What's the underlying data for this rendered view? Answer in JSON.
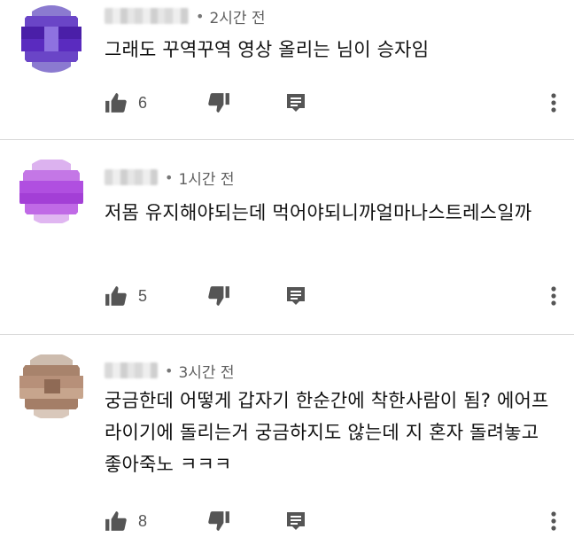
{
  "comments": [
    {
      "time_ago": "2시간 전",
      "separator": "•",
      "text": "그래도 꾸역꾸역 영상 올리는 님이 승자임",
      "likes": "6",
      "avatar_color": "#5a2bbf"
    },
    {
      "time_ago": "1시간 전",
      "separator": "•",
      "text": "저몸 유지해야되는데 먹어야되니까얼마나스트레스일까",
      "likes": "5",
      "avatar_color": "#b04fe0"
    },
    {
      "time_ago": "3시간 전",
      "separator": "•",
      "text": "궁금한데 어떻게 갑자기 한순간에 착한사람이 됨? 에어프라이기에 돌리는거 궁금하지도 않는데 지 혼자 돌려놓고 좋아죽노 ㅋㅋㅋ",
      "likes": "8",
      "avatar_color": "#b79079"
    }
  ],
  "icons": {
    "like": "thumbs-up-icon",
    "dislike": "thumbs-down-icon",
    "reply": "reply-icon",
    "more": "more-vert-icon"
  },
  "colors": {
    "text": "#111111",
    "secondary": "#606060",
    "icon": "#555555",
    "divider": "#dadada"
  }
}
